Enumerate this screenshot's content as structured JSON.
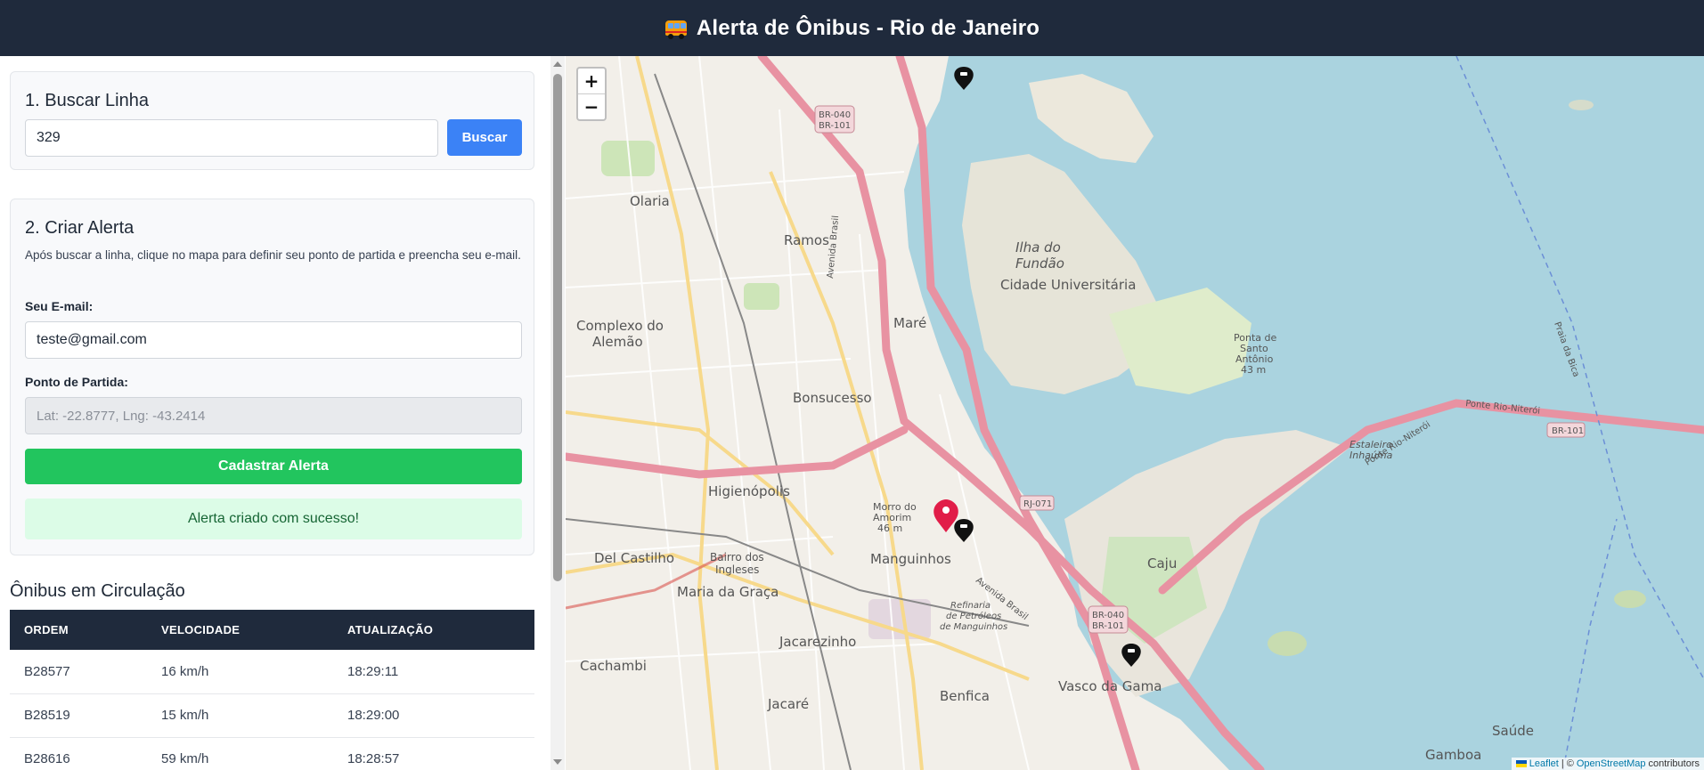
{
  "header": {
    "title": "Alerta de Ônibus - Rio de Janeiro",
    "icon": "bus-icon"
  },
  "search": {
    "title": "1. Buscar Linha",
    "value": "329",
    "button": "Buscar"
  },
  "alert": {
    "title": "2. Criar Alerta",
    "hint": "Após buscar a linha, clique no mapa para definir seu ponto de partida e preencha seu e-mail.",
    "email_label": "Seu E-mail:",
    "email_value": "teste@gmail.com",
    "start_label": "Ponto de Partida:",
    "start_placeholder": "Lat: -22.8777, Lng: -43.2414",
    "button": "Cadastrar Alerta",
    "success": "Alerta criado com sucesso!"
  },
  "buses": {
    "title": "Ônibus em Circulação",
    "columns": [
      "ORDEM",
      "VELOCIDADE",
      "ATUALIZAÇÃO"
    ],
    "rows": [
      [
        "B28577",
        "16 km/h",
        "18:29:11"
      ],
      [
        "B28519",
        "15 km/h",
        "18:29:00"
      ],
      [
        "B28616",
        "59 km/h",
        "18:28:57"
      ]
    ]
  },
  "map": {
    "zoom_in": "+",
    "zoom_out": "−",
    "attribution": {
      "leaflet": "Leaflet",
      "sep": "| ©",
      "osm": "OpenStreetMap",
      "suffix": "contributors"
    },
    "labels": {
      "olaria": "Olaria",
      "ramos": "Ramos",
      "ilha": "Ilha do",
      "fundao": "Fundão",
      "cidade": "Cidade Universitária",
      "mare": "Maré",
      "complexo": "Complexo do",
      "alemao": "Alemão",
      "bonsucesso": "Bonsucesso",
      "higienopolis": "Higienópolis",
      "manguinhos": "Manguinhos",
      "castilho": "Del Castilho",
      "bairro": "Bairro dos",
      "ingleses": "Ingleses",
      "mariagraca": "Maria da Graça",
      "jacarezinho": "Jacarezinho",
      "cachambi": "Cachambi",
      "jacare": "Jacaré",
      "benfica": "Benfica",
      "caju": "Caju",
      "vasco": "Vasco da Gama",
      "refinaria1": "Refinaria",
      "refinaria2": "de Petróleos",
      "refinaria3": "de Manguinhos",
      "ponte": "Ponte Rio-Niterói",
      "br101": "BR-101",
      "br040": "BR-040",
      "rj071": "RJ-071",
      "avbrasil": "Avenida Brasil",
      "gamboa": "Gamboa",
      "saude": "Saúde",
      "morro1": "Morro do",
      "morro2": "Amorim",
      "morro3": "46 m",
      "santo1": "Ponta de",
      "santo2": "Santo",
      "santo3": "Antônio",
      "santo4": "43 m",
      "estaleiro1": "Estaleiro",
      "estaleiro2": "Inhaúma",
      "praia": "Praia da Bica"
    },
    "colors": {
      "water": "#aad3df",
      "road": "#e892a2",
      "land": "#f2efe9",
      "marker": "#e11d48"
    }
  }
}
